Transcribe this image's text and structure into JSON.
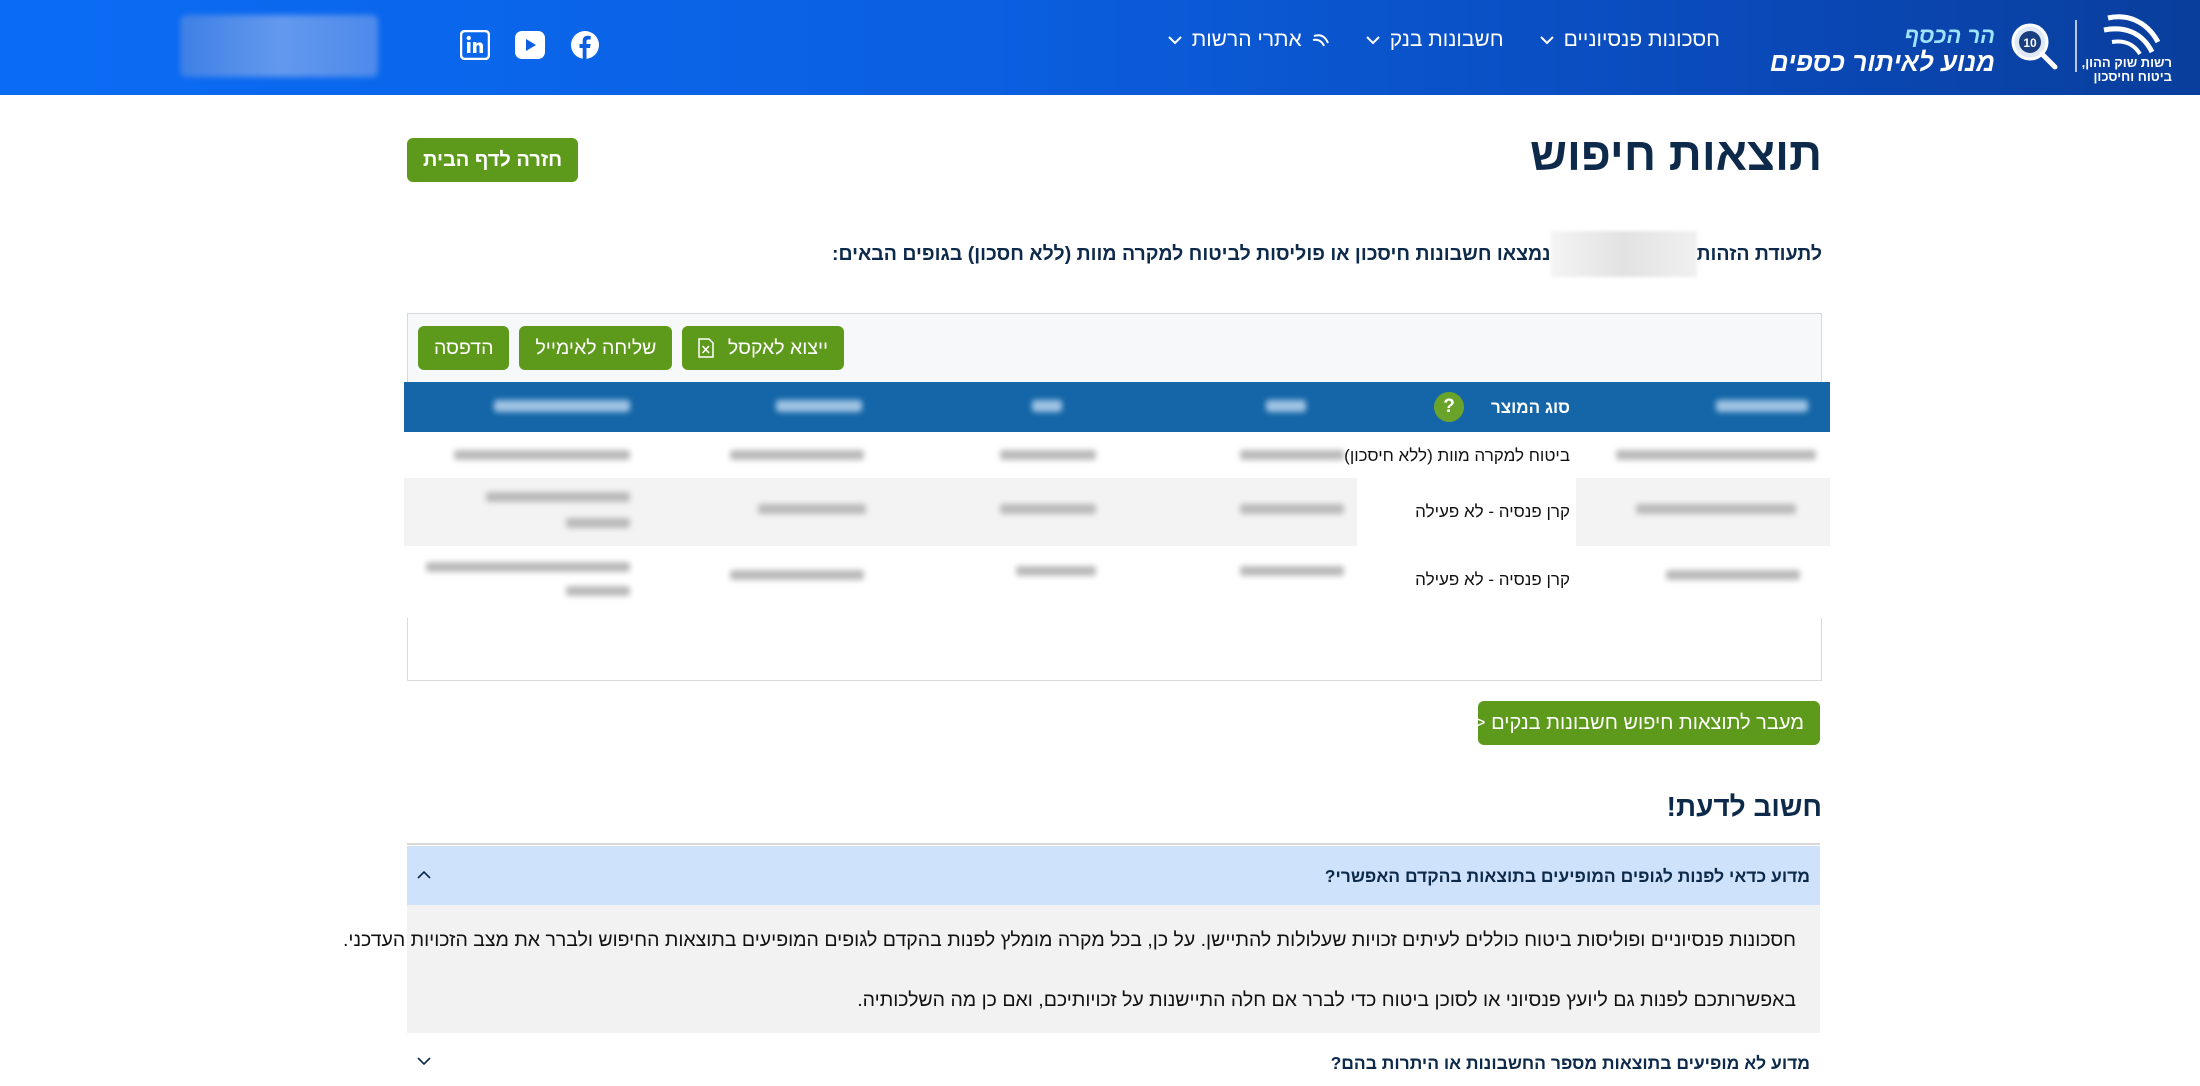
{
  "header": {
    "authority_logo_text_line1": "רשות שוק ההון,",
    "authority_logo_text_line2": "ביטוח וחיסכון",
    "badge_text": "10",
    "brand_line1": "הר הכסף",
    "brand_line2": "מנוע לאיתור כספים",
    "nav": [
      {
        "label": "חסכונות פנסיוניים"
      },
      {
        "label": "חשבונות בנק"
      },
      {
        "label": "אתרי הרשות"
      }
    ],
    "social": [
      "facebook-icon",
      "youtube-icon",
      "linkedin-icon"
    ]
  },
  "page": {
    "title": "תוצאות חיפוש",
    "back_button": "חזרה לדף הבית",
    "id_line_prefix": "לתעודת הזהות",
    "id_line_suffix": "נמצאו חשבונות חיסכון או פוליסות לביטוח למקרה מוות (ללא חסכון) בגופים הבאים:"
  },
  "toolbar": {
    "excel": "ייצוא לאקסל",
    "email": "שליחה לאימייל",
    "print": "הדפסה"
  },
  "table": {
    "product_type_header": "סוג המוצר",
    "help_icon": "?",
    "rows": [
      {
        "product_type": "ביטוח למקרה מוות (ללא חיסכון)"
      },
      {
        "product_type": "קרן פנסיה - לא פעילה"
      },
      {
        "product_type": "קרן פנסיה - לא פעילה"
      }
    ]
  },
  "bank_results_button": "מעבר לתוצאות חיפוש חשבונות בנקים <<",
  "important": {
    "title": "חשוב לדעת!",
    "faq": [
      {
        "question": "מדוע כדאי לפנות לגופים המופיעים בתוצאות בהקדם האפשרי?",
        "answer_p1": "חסכונות פנסיוניים ופוליסות ביטוח כוללים לעיתים זכויות שעלולות להתיישן. על כן, בכל מקרה מומלץ לפנות בהקדם לגופים המופיעים בתוצאות החיפוש ולברר את מצב הזכויות העדכני.",
        "answer_p2": "באפשרותכם לפנות גם ליועץ פנסיוני או לסוכן ביטוח כדי לברר אם חלה התיישנות על זכויותיכם, ואם כן מה השלכותיה."
      },
      {
        "question": "מדוע לא מופיעים בתוצאות מספר החשבונות או היתרות בהם?"
      }
    ]
  },
  "colors": {
    "header_blue": "#0a5fe0",
    "brand_green": "#5d9a1b",
    "table_header": "#1466a8",
    "accordion_open": "#cfe2fb"
  }
}
